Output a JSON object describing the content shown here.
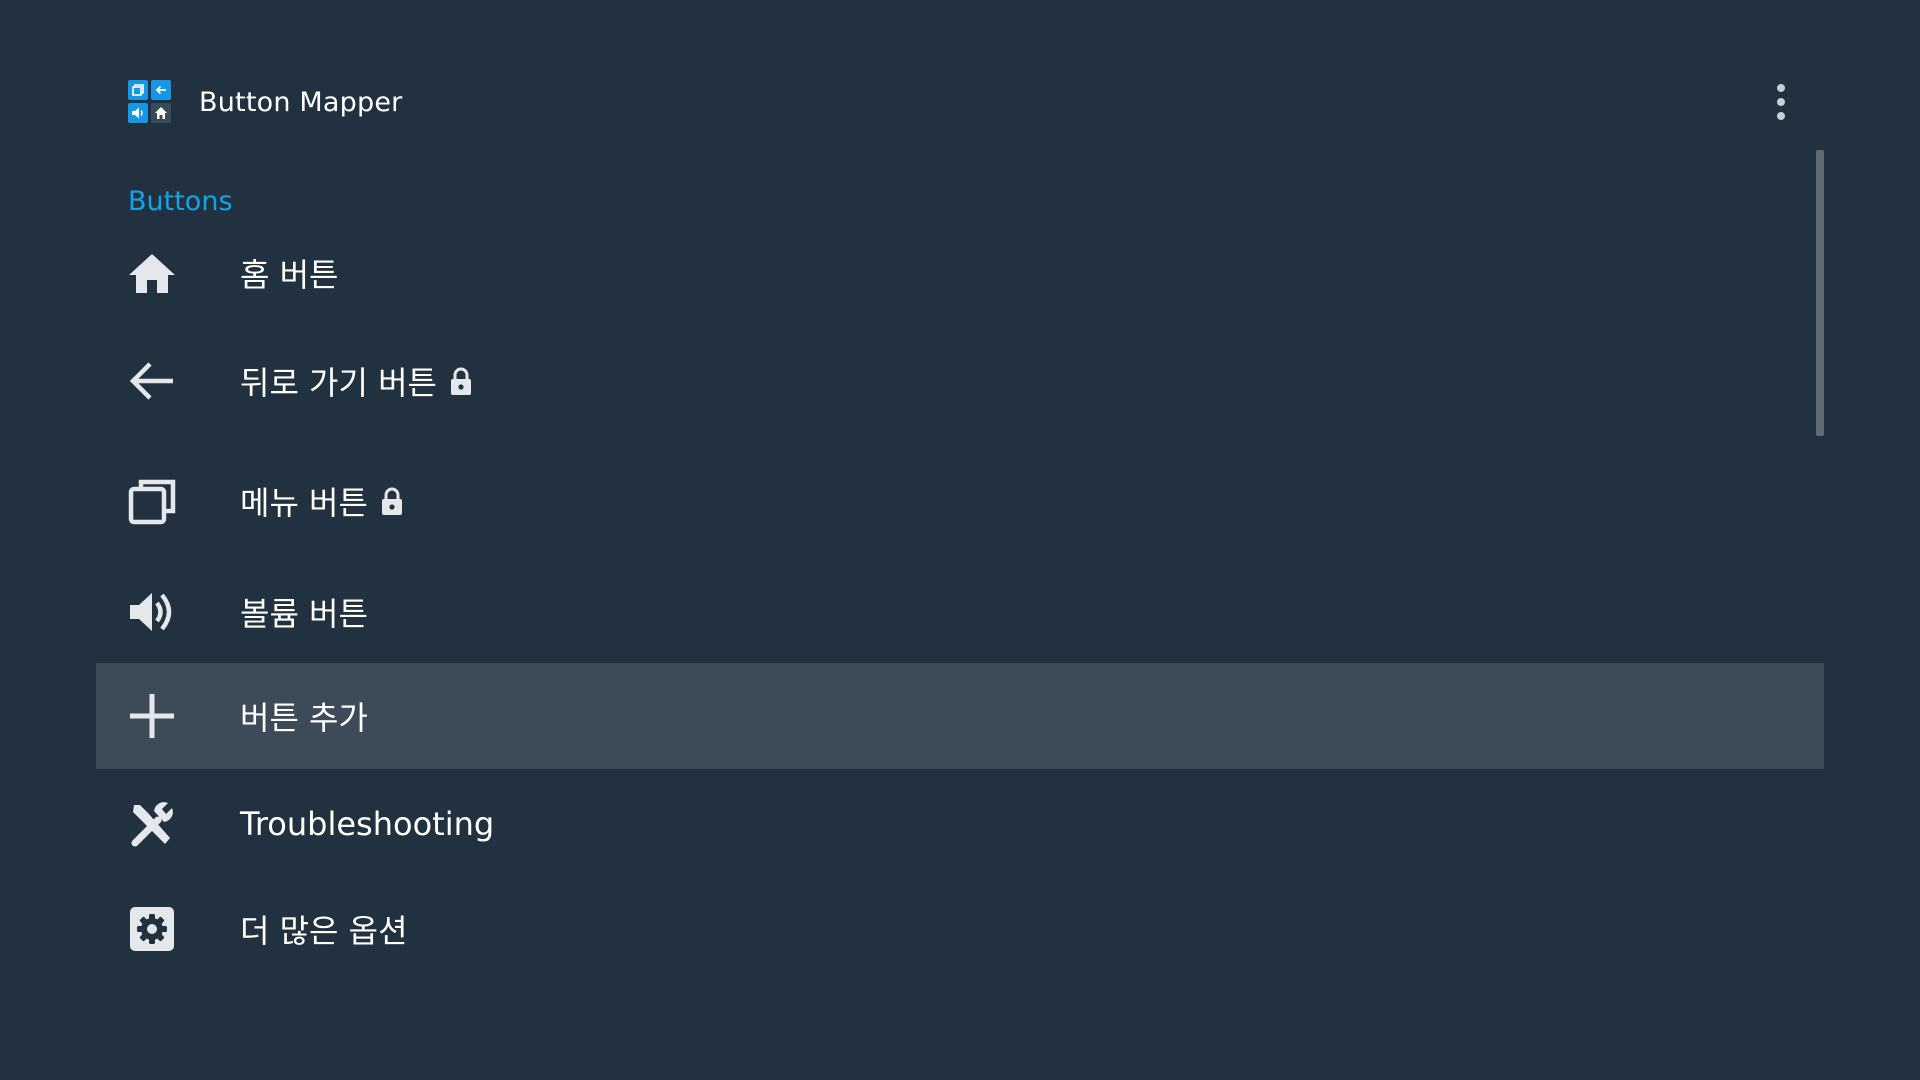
{
  "app": {
    "title": "Button Mapper",
    "logo_icon": "button-mapper-logo-icon",
    "overflow_icon": "more-vertical-icon"
  },
  "colors": {
    "background": "#22313f",
    "accent": "#13a4e8",
    "focused_row": "#3d4b58",
    "text": "#ffffff",
    "icon": "#e4e8ec"
  },
  "section": {
    "header": "Buttons"
  },
  "menu": {
    "items": [
      {
        "label": "홈 버튼",
        "icon": "home-icon",
        "locked": false,
        "focused": false
      },
      {
        "label": "뒤로 가기 버튼",
        "icon": "back-arrow-icon",
        "locked": true,
        "focused": false
      },
      {
        "label": "메뉴 버튼",
        "icon": "recent-apps-icon",
        "locked": true,
        "focused": false
      },
      {
        "label": "볼륨 버튼",
        "icon": "volume-icon",
        "locked": false,
        "focused": false
      },
      {
        "label": "버튼 추가",
        "icon": "add-icon",
        "locked": false,
        "focused": true
      },
      {
        "label": "Troubleshooting",
        "icon": "tools-icon",
        "locked": false,
        "focused": false
      },
      {
        "label": "더 많은 옵션",
        "icon": "settings-icon",
        "locked": false,
        "focused": false
      }
    ]
  }
}
